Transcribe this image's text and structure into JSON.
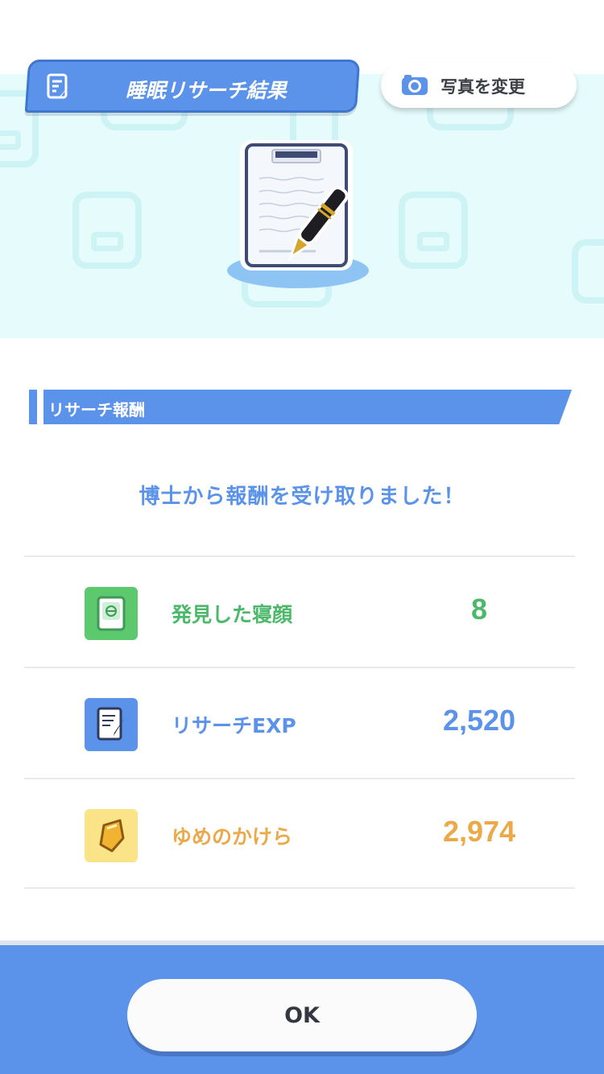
{
  "header": {
    "title": "睡眠リサーチ結果",
    "photo_button_label": "写真を変更"
  },
  "section": {
    "title": "リサーチ報酬"
  },
  "message": "博士から報酬を受け取りました！",
  "rewards": [
    {
      "label": "発見した寝顔",
      "value": "8",
      "icon": "pokedex-icon",
      "color": "#4cb96a",
      "icon_bg": "#5cc96f"
    },
    {
      "label": "リサーチEXP",
      "value": "2,520",
      "icon": "research-notes-icon",
      "color": "#5b93ea",
      "icon_bg": "#5b93ea"
    },
    {
      "label": "ゆめのかけら",
      "value": "2,974",
      "icon": "dream-shard-icon",
      "color": "#eba94a",
      "icon_bg": "#fbe487"
    }
  ],
  "footer": {
    "ok_label": "OK"
  },
  "colors": {
    "accent": "#5b93ea",
    "banner_bg": "#e5fbfc"
  }
}
